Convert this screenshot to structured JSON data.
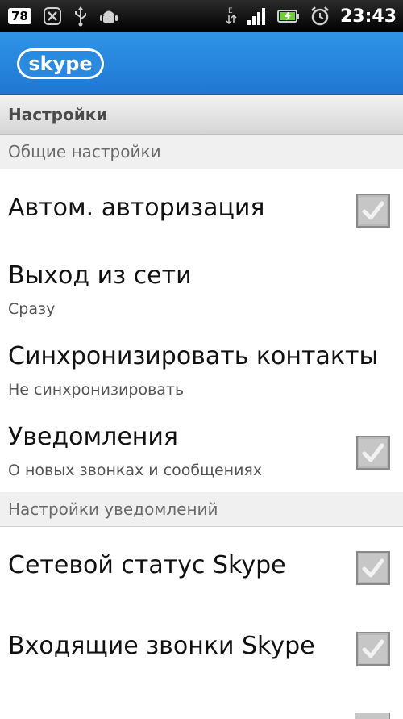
{
  "status_bar": {
    "badge": "78",
    "time": "23:43",
    "icons": [
      "notification-count-badge",
      "missed-call-icon",
      "usb-icon",
      "android-debug-icon",
      "data-arrows-icon",
      "signal-icon",
      "battery-icon",
      "alarm-icon"
    ]
  },
  "app": {
    "logo_text": "skype",
    "brand_color": "#1e78d3"
  },
  "page": {
    "title": "Настройки"
  },
  "sections": [
    {
      "header": "Общие настройки",
      "items": [
        {
          "title": "Автом. авторизация",
          "summary": "",
          "checked": true
        },
        {
          "title": "Выход из сети",
          "summary": "Сразу"
        },
        {
          "title": "Синхронизировать контакты",
          "summary": "Не синхронизировать"
        },
        {
          "title": "Уведомления",
          "summary": "О новых звонках и сообщениях",
          "checked": true
        }
      ]
    },
    {
      "header": "Настройки уведомлений",
      "items": [
        {
          "title": "Сетевой статус Skype",
          "summary": "",
          "checked": true
        },
        {
          "title": "Входящие звонки Skype",
          "summary": "",
          "checked": true
        }
      ]
    }
  ]
}
